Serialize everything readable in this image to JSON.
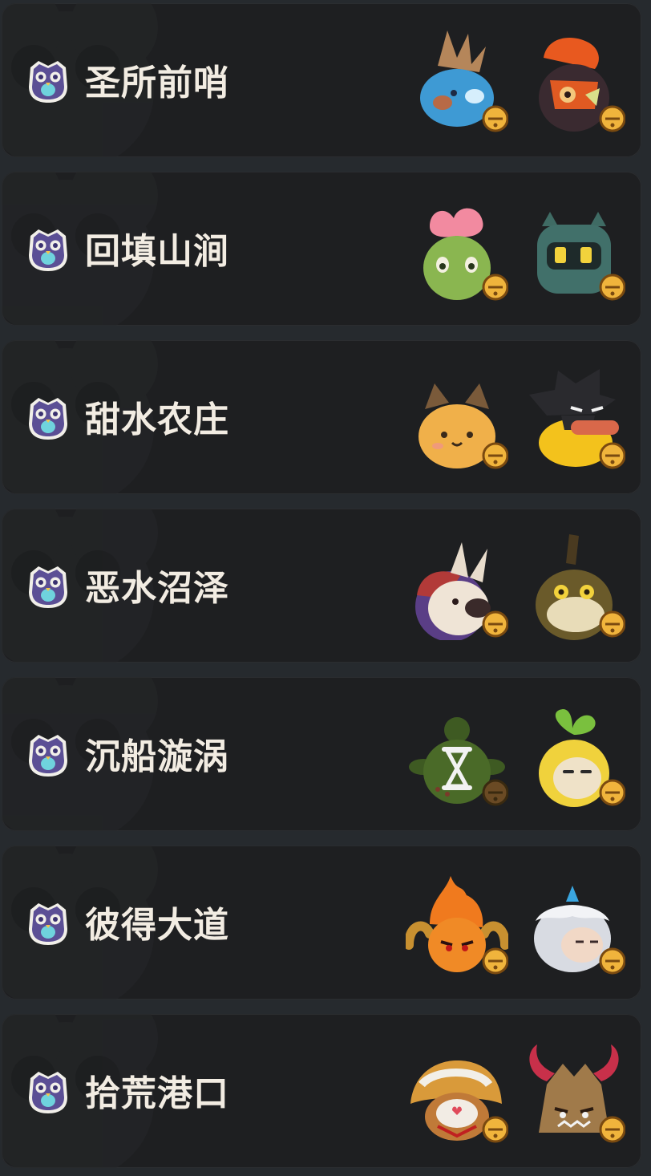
{
  "regions": [
    {
      "name": "圣所前哨",
      "pets": [
        {
          "icon": "blue-feather-pet-icon"
        },
        {
          "icon": "red-bird-pet-icon"
        }
      ]
    },
    {
      "name": "回填山涧",
      "pets": [
        {
          "icon": "green-frog-pet-icon"
        },
        {
          "icon": "teal-robot-pet-icon"
        }
      ]
    },
    {
      "name": "甜水农庄",
      "pets": [
        {
          "icon": "orange-cat-pet-icon"
        },
        {
          "icon": "black-duck-pet-icon"
        }
      ]
    },
    {
      "name": "恶水沼泽",
      "pets": [
        {
          "icon": "bunny-pet-icon"
        },
        {
          "icon": "olive-beetle-pet-icon"
        }
      ]
    },
    {
      "name": "沉船漩涡",
      "pets": [
        {
          "icon": "green-sprout-pet-icon",
          "locked": true,
          "status_icon": "hourglass-icon"
        },
        {
          "icon": "yellow-sprout-pet-icon"
        }
      ]
    },
    {
      "name": "彼得大道",
      "pets": [
        {
          "icon": "fire-pet-icon"
        },
        {
          "icon": "white-ghost-pet-icon"
        }
      ]
    },
    {
      "name": "拾荒港口",
      "pets": [
        {
          "icon": "straw-hat-pet-icon"
        },
        {
          "icon": "horned-dragon-pet-icon"
        }
      ]
    }
  ]
}
